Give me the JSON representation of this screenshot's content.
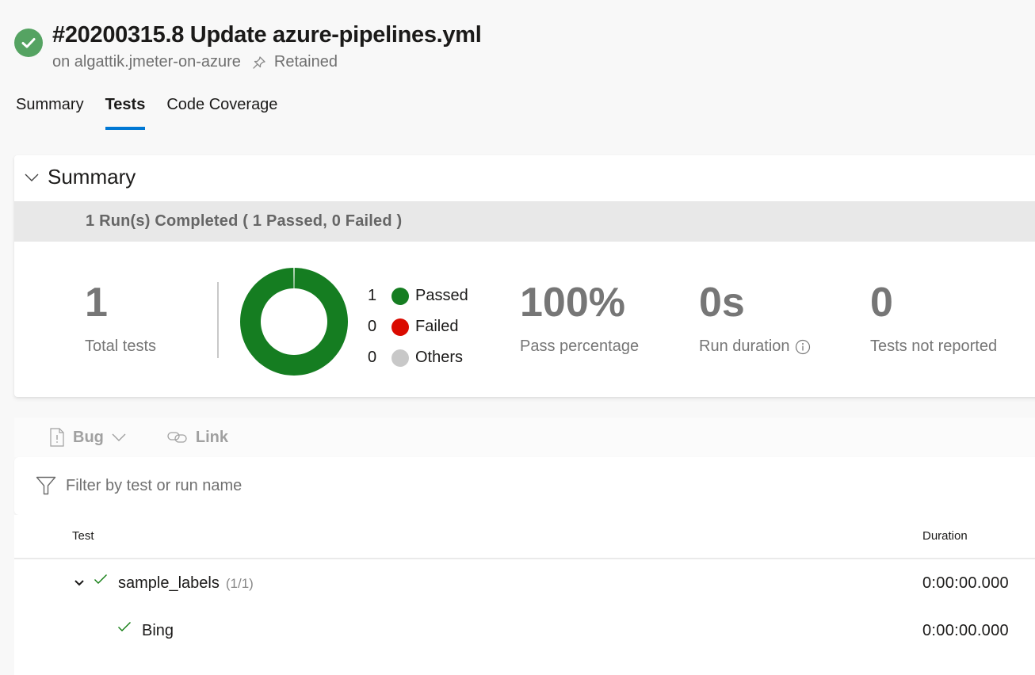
{
  "header": {
    "status_icon": "success-check-icon",
    "title": "#20200315.8 Update azure-pipelines.yml",
    "repo": "on algattik.jmeter-on-azure",
    "pin_icon": "pin-icon",
    "retained": "Retained"
  },
  "tabs": [
    {
      "label": "Summary",
      "active": false
    },
    {
      "label": "Tests",
      "active": true
    },
    {
      "label": "Code Coverage",
      "active": false
    }
  ],
  "summary": {
    "section_title": "Summary",
    "run_status": "1 Run(s) Completed ( 1 Passed, 0 Failed )",
    "total_tests": {
      "value": "1",
      "label": "Total tests"
    },
    "pass_percentage": {
      "value": "100%",
      "label": "Pass percentage"
    },
    "run_duration": {
      "value": "0s",
      "label": "Run duration"
    },
    "tests_not_reported": {
      "value": "0",
      "label": "Tests not reported"
    },
    "legend": [
      {
        "count": "1",
        "label": "Passed",
        "color": "#107c10"
      },
      {
        "count": "0",
        "label": "Failed",
        "color": "#da0a00"
      },
      {
        "count": "0",
        "label": "Others",
        "color": "#c8c8c8"
      }
    ]
  },
  "chart_data": {
    "type": "pie",
    "title": "",
    "categories": [
      "Passed",
      "Failed",
      "Others"
    ],
    "values": [
      1,
      0,
      0
    ],
    "colors": [
      "#157d21",
      "#da0a00",
      "#c8c8c8"
    ],
    "donut": true,
    "legend": "right"
  },
  "toolbar": {
    "bug_label": "Bug",
    "link_label": "Link"
  },
  "filter": {
    "placeholder": "Filter by test or run name"
  },
  "table": {
    "columns": [
      "Test",
      "Duration"
    ],
    "rows": [
      {
        "name": "sample_labels",
        "count": "(1/1)",
        "duration": "0:00:00.000",
        "status": "passed",
        "expanded": true
      },
      {
        "name": "Bing",
        "count": "",
        "duration": "0:00:00.000",
        "status": "passed"
      }
    ]
  },
  "colors": {
    "accent": "#0078d4",
    "success": "#55a362",
    "passed": "#107c10"
  }
}
